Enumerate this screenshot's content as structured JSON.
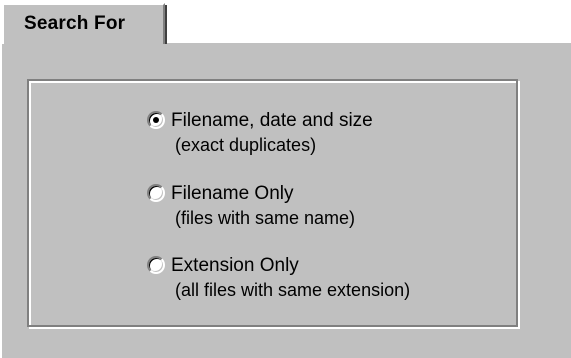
{
  "tab": {
    "label": "Search For"
  },
  "search_options": [
    {
      "label": "Filename, date and size",
      "description": "(exact duplicates)",
      "selected": true
    },
    {
      "label": "Filename Only",
      "description": "(files with same name)",
      "selected": false
    },
    {
      "label": "Extension Only",
      "description": "(all files with same extension)",
      "selected": false
    }
  ]
}
